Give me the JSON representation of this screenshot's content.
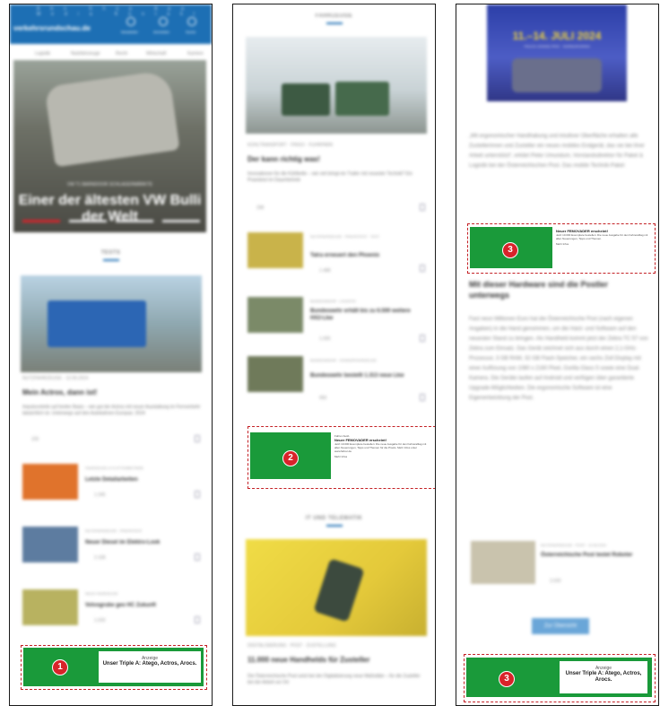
{
  "panel1": {
    "topbar_menu": "Abo  Shop  App  Media  Kontakt",
    "logo": "verkehrsrundschau.de",
    "icon_labels": [
      "Newsletter",
      "Anmelden",
      "Suche"
    ],
    "nav_tabs": [
      "Logistik",
      "Nutzfahrzeuge",
      "Recht",
      "Wirtschaft",
      "Karriere"
    ],
    "hero_kicker": "VW T1 BARNDOOR SCHLAGERMÄRKTE",
    "hero_title": "Einer der ältesten VW Bulli der Welt",
    "section": "TESTS",
    "main_meta": "NUTZFAHRZEUGE · 12.06.2024",
    "main_headline": "Mein Actros, dann ist!",
    "main_body": "Impulsvorteile auf breiter Basis – wie gut der Actros mit neuer Ausstattung im Fernverkehr tatsächlich ist. Unterwegs auf den Autobahnen Europas: 2024",
    "main_count": "230",
    "rows": [
      {
        "meta": "FAHRZEUGE & FLOTTENBETRIEB",
        "title": "Letzte Detailarbeiten",
        "count": "1.345",
        "color": "#e0732c"
      },
      {
        "meta": "NUTZFAHRZEUGE · PRAXISTEST",
        "title": "Neuer Diesel im Elektro-Look",
        "count": "2.168",
        "color": "#5d7ca0"
      },
      {
        "meta": "NEUE FAHRZEUGE",
        "title": "Volvogrube geo HC Zukunft",
        "count": "1.020",
        "color": "#b8b260"
      }
    ],
    "ad_label": "Anzeige",
    "ad_title": "Unser Triple A: Atego, Actros, Arocs.",
    "ad_badge": "1"
  },
  "panel2": {
    "section_top": "FAHRZEUGE",
    "main_meta": "KÜHLTRANSPORT · FRIGO · FUHRPARK",
    "main_headline": "Der kann richtig was!",
    "main_body": "Innovationen für die Kühlkette – wie viel bringt ein Trailer mit neuester Technik? Ein Praxistest im Dauerbetrieb",
    "main_count": "298",
    "rows": [
      {
        "meta": "NUTZFAHRZEUGE · PRAXISTEST · TEST",
        "title": "Tatra erneuert den Phoenix",
        "count": "1.488",
        "color": "#c9b34a"
      },
      {
        "meta": "BUNDESWEHR · LOGISTIK",
        "title": "Bundeswehr erhält bis zu 6.500 weitere HX2-Lkw",
        "count": "1.005",
        "color": "#7b8a68"
      },
      {
        "meta": "BUNDESWEHR · SONDERFAHRZEUGE",
        "title": "Bundeswehr bestellt 1.313 neue Lkw",
        "count": "956",
        "color": "#6f7a5a"
      }
    ],
    "ad_kicker": "Fahrer Ausb.",
    "ad_title": "Neuer FEMOVADER erscheint!",
    "ad_body": "Jetzt 10.000 Exemplare bestellen: Die neue Ausgabe für den Fahreralltag mit allen Neuerungen, Tipps und Themen für die Praxis. Mehr Infos unter www.fahrer.de",
    "ad_more": "Mehr Infos",
    "ad_badge": "2",
    "section_bottom": "IT UND TELEMATIK",
    "bottom_meta": "DIGITALISIERUNG · POST · ZUSTELLUNG",
    "bottom_headline": "11.000 neue Handhelds für Zusteller",
    "bottom_body": "Die Österreichische Post setzt bei der Digitalisierung neue Maßstäbe – für die Zusteller bei der Arbeit vor Ort"
  },
  "panel3": {
    "poster_date": "11.–14. JULI 2024",
    "poster_sub": "TRUCK-GRAND-PRIX · NÜRBURGRING",
    "para1": "„Mit ergonomischer Handhabung und intuitiver Oberfläche erhalten alle Zustellerinnen und Zusteller ein neues mobiles Endgerät, das sie bei ihrer Arbeit unterstützt“, erklärt Peter Umundum, Vorstandsdirektor für Paket & Logistik bei der Österreichischen Post. Das mobile Technik-Paket",
    "ad_title": "Neuer FEMOVADER erscheint!",
    "ad_body": "Jetzt 10.000 Exemplare bestellen: Die neue Ausgabe für den Fahreralltag mit allen Neuerungen, Tipps und Themen.",
    "ad_more": "Mehr Infos",
    "ad_badge": "3",
    "subhead": "Mit dieser Hardware sind die Postler unterwegs",
    "para2": "Fast neun Millionen Euro hat die Österreichische Post (nach eigenen Angaben) in die Hand genommen, um die Hard- und Software auf den neuesten Stand zu bringen. Als Handheld kommt jetzt der Zebra TC 57 von Zebra zum Einsatz. Das Gerät zeichnet sich aus durch einen 2,1-GHz-Prozessor, 3 GB RAM, 32 GB Flash-Speicher, ein sechs Zoll Display mit einer Auflösung von 1080 x 2160 Pixel, Gorilla Glass 5 sowie eine Dual-Kamera. Die Geräte laufen auf Android und verfügen über garantierte Upgrade-Möglichkeiten. Die ergonomische Software ist eine Eigenentwicklung der Post.",
    "related_meta": "NUTZFAHRZEUGE · POST · 14.06.2024",
    "related_title": "Österreichische Post testet Roboter",
    "related_count": "2.020",
    "button": "Zur Übersicht",
    "ad2_label": "Anzeige",
    "ad2_title": "Unser Triple A: Atego, Actros, Arocs.",
    "ad2_badge": "3"
  }
}
